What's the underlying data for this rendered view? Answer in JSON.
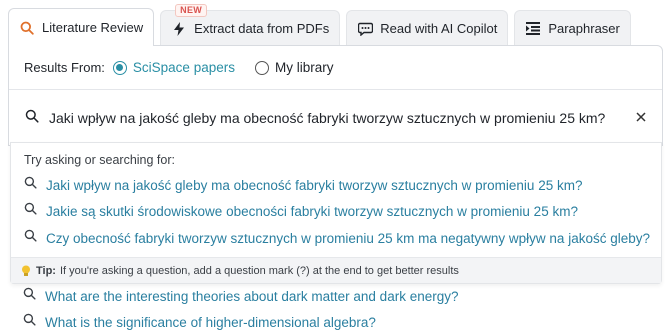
{
  "tabs": [
    {
      "label": "Literature Review",
      "icon": "search-icon",
      "active": true
    },
    {
      "label": "Extract data from PDFs",
      "icon": "bolt-icon",
      "badge": "NEW"
    },
    {
      "label": "Read with AI Copilot",
      "icon": "chat-icon"
    },
    {
      "label": "Paraphraser",
      "icon": "paraphrase-icon"
    }
  ],
  "results": {
    "label": "Results From:",
    "options": [
      {
        "label": "SciSpace papers",
        "selected": true
      },
      {
        "label": "My library",
        "selected": false
      }
    ]
  },
  "search": {
    "query": "Jaki wpływ na jakość gleby ma obecność fabryki tworzyw sztucznych w promieniu 25 km?"
  },
  "suggestions": {
    "title": "Try asking or searching for:",
    "items": [
      "Jaki wpływ na jakość gleby ma obecność fabryki tworzyw sztucznych w promieniu 25 km?",
      "Jakie są skutki środowiskowe obecności fabryki tworzyw sztucznych w promieniu 25 km?",
      "Czy obecność fabryki tworzyw sztucznych w promieniu 25 km ma negatywny wpływ na jakość gleby?"
    ],
    "tip_label": "Tip:",
    "tip_text": "If you're asking a question, add a question mark (?) at the end to get better results"
  },
  "background_items": [
    "What are the interesting theories about dark matter and dark energy?",
    "What is the significance of higher-dimensional algebra?"
  ],
  "colors": {
    "accent": "#2a8fa5",
    "link": "#2a7fa0",
    "badge": "#d9534f"
  }
}
